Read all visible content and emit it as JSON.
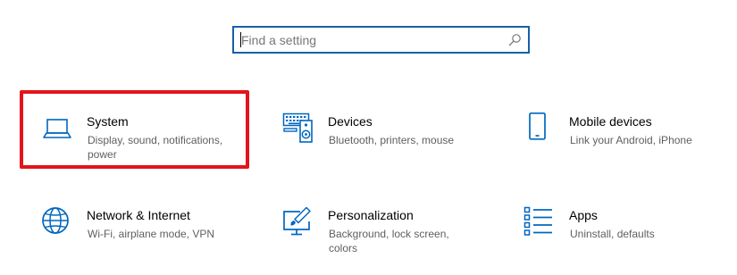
{
  "search": {
    "placeholder": "Find a setting",
    "value": ""
  },
  "tiles": [
    {
      "title": "System",
      "description": "Display, sound, notifications, power",
      "icon": "laptop-icon"
    },
    {
      "title": "Devices",
      "description": "Bluetooth, printers, mouse",
      "icon": "keyboard-speaker-icon"
    },
    {
      "title": "Mobile devices",
      "description": "Link your Android, iPhone",
      "icon": "phone-icon"
    },
    {
      "title": "Network & Internet",
      "description": "Wi-Fi, airplane mode, VPN",
      "icon": "globe-icon"
    },
    {
      "title": "Personalization",
      "description": "Background, lock screen, colors",
      "icon": "paintbrush-monitor-icon"
    },
    {
      "title": "Apps",
      "description": "Uninstall, defaults",
      "icon": "apps-list-icon"
    }
  ],
  "colors": {
    "accent": "#0067c0",
    "search_border": "#1a5fa8",
    "highlight": "#e3141b",
    "title_text": "#000000",
    "description_text": "#5f5f5f"
  }
}
